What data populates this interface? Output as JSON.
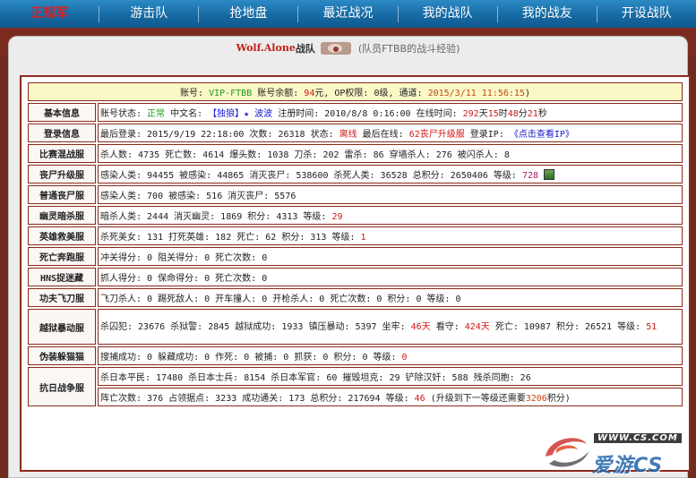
{
  "nav": {
    "items": [
      {
        "label": "正规军",
        "active": true
      },
      {
        "label": "游击队"
      },
      {
        "label": "抢地盘"
      },
      {
        "label": "最近战况"
      },
      {
        "label": "我的战队"
      },
      {
        "label": "我的战友"
      },
      {
        "label": "开设战队"
      }
    ]
  },
  "team": {
    "name": "Wolf.Alone",
    "suffix": "战队",
    "subtitle": "(队员FTBB的战斗经验)"
  },
  "account": {
    "p1": "账号: ",
    "id": "VIP-FTBB",
    "p2": " 账号余额: ",
    "balance": "94",
    "p3": "元, OP权限: 0级, 通道: ",
    "time": "2015/3/11 11:56:15",
    "p4": ")"
  },
  "rows": {
    "basic": {
      "label": "基本信息",
      "t1": "账号状态: ",
      "status": "正常",
      "t2": " 中文名: ",
      "cname1": "【独狼】",
      "star": "★",
      "cname2": " 波波",
      "t3": " 注册时间: 2010/8/8 0:16:00 在线时间: ",
      "days": "292",
      "u1": "天",
      "hours": "15",
      "u2": "时",
      "mins": "48",
      "u3": "分",
      "secs": "21",
      "u4": "秒"
    },
    "login": {
      "label": "登录信息",
      "t1": "最后登录: 2015/9/19 22:18:00 次数: 26318 状态: ",
      "state": "离线",
      "t2": " 最后在线: ",
      "server": "62丧尸升级服",
      "t3": " 登录IP: ",
      "ip": "《点击查看IP》"
    },
    "mixed": {
      "label": "比赛混战服",
      "text": "杀人数: 4735 死亡数: 4614 爆头数: 1038 刀杀: 202 雷杀: 86 穿墙杀人: 276 被闪杀人: 8"
    },
    "zombie_upgrade": {
      "label": "丧尸升级服",
      "text": "感染人类: 94455 被感染: 44865 消灭丧尸: 538600 杀死人类: 36528 总积分: 2650406 等级: ",
      "level": "728"
    },
    "zombie_normal": {
      "label": "普通丧尸服",
      "text": "感染人类: 700 被感染: 516 消灭丧尸: 5576"
    },
    "ghost": {
      "label": "幽灵暗杀服",
      "text": "暗杀人类: 2444 消灭幽灵: 1869 积分: 4313 等级: ",
      "level": "29"
    },
    "hero": {
      "label": "英雄救美服",
      "text": "杀死美女: 131 打死英雄: 182 死亡: 62 积分: 313 等级: ",
      "level": "1"
    },
    "deathrun": {
      "label": "死亡奔跑服",
      "text": "冲关得分: 0 阻关得分: 0 死亡次数: 0"
    },
    "hns": {
      "label": "HNS捉迷藏",
      "text": "抓人得分: 0 保命得分: 0 死亡次数: 0"
    },
    "kungfu": {
      "label": "功夫飞刀服",
      "text": "飞刀杀人: 0 踢死敌人: 0 开车撞人: 0 开枪杀人: 0 死亡次数: 0 积分: 0 等级: 0"
    },
    "jailbreak": {
      "label": "越狱暴动服",
      "t1": "杀囚犯: 23676 杀狱警: 2845 越狱成功: 1933 镇压暴动: 5397 坐牢: ",
      "d1": "46天",
      "t2": " 看守: ",
      "d2": "424天",
      "t3": " 死亡: 10987 积分: 26521 等级: ",
      "level": "51"
    },
    "catch": {
      "label": "伪装躲猫猫",
      "text": "搜捕成功: 0 躲藏成功: 0 作死: 0 被捕: 0 抓获: 0 积分: 0 等级: ",
      "level": "0"
    },
    "war": {
      "label": "抗日战争服",
      "line1": "杀日本平民: 17480 杀日本士兵: 8154 杀日本军官: 60 摧毁坦克: 29 铲除汉奸: 588 残杀同胞: 26",
      "line2a": "阵亡次数: 376 占领据点: 3233 成功通关: 173 总积分: 217694 等级: ",
      "level": "46",
      "line2b": " (升级到下一等级还需要",
      "need": "3206",
      "line2c": "积分)"
    }
  },
  "watermark": {
    "url": "WWW.CS.COM",
    "brand": "爱游CS"
  },
  "colors": {
    "nav_bg": "#176aa3",
    "frame_border": "#8a2a1a",
    "label_color": "#a0141a",
    "page_bg": "#6e2b1e"
  }
}
